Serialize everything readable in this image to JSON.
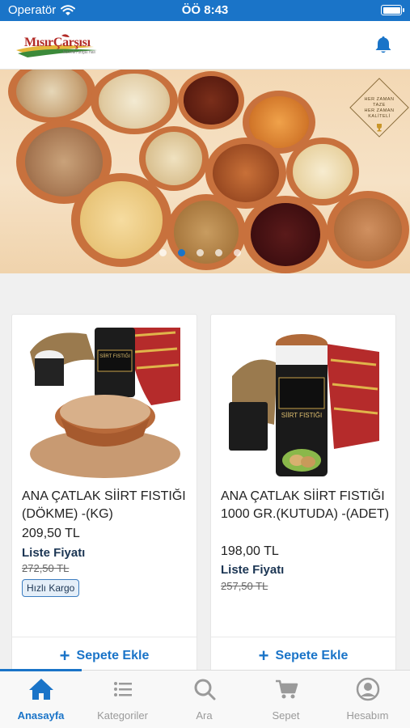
{
  "status_bar": {
    "carrier": "Operatör",
    "time": "ÖÖ 8:43"
  },
  "header": {
    "logo_text": "MısırÇarşısı",
    "logo_sub": "lezzetin doğal hali",
    "logo_icon": "brand-logo",
    "notification_icon": "bell-icon"
  },
  "banner": {
    "badge_text": [
      "HER ZAMAN",
      "TAZE",
      "HER ZAMAN",
      "KALİTELİ"
    ],
    "slide_count": 5,
    "active_slide": 2
  },
  "products": [
    {
      "name": "ANA ÇATLAK SİİRT FISTIĞI (DÖKME) -(KG)",
      "price": "209,50 TL",
      "list_label": "Liste Fiyatı",
      "old_price": "272,50 TL",
      "badge": "Hızlı Kargo",
      "add_label": "Sepete Ekle",
      "pkg_text": "SİİRT FISTIĞI"
    },
    {
      "name": "ANA ÇATLAK SİİRT FISTIĞI 1000 GR.(KUTUDA) -(ADET)",
      "price": "198,00 TL",
      "list_label": "Liste Fiyatı",
      "old_price": "257,50 TL",
      "add_label": "Sepete Ekle",
      "pkg_text": "SİİRT FISTIĞI"
    }
  ],
  "tabbar": {
    "tabs": [
      {
        "label": "Anasayfa",
        "icon": "home-icon"
      },
      {
        "label": "Kategoriler",
        "icon": "list-icon"
      },
      {
        "label": "Ara",
        "icon": "search-icon"
      },
      {
        "label": "Sepet",
        "icon": "cart-icon"
      },
      {
        "label": "Hesabım",
        "icon": "account-icon"
      }
    ],
    "active_tab": 0
  },
  "colors": {
    "primary": "#1a74c8",
    "brand_red": "#b22a26",
    "dark_text": "#1b3553"
  }
}
